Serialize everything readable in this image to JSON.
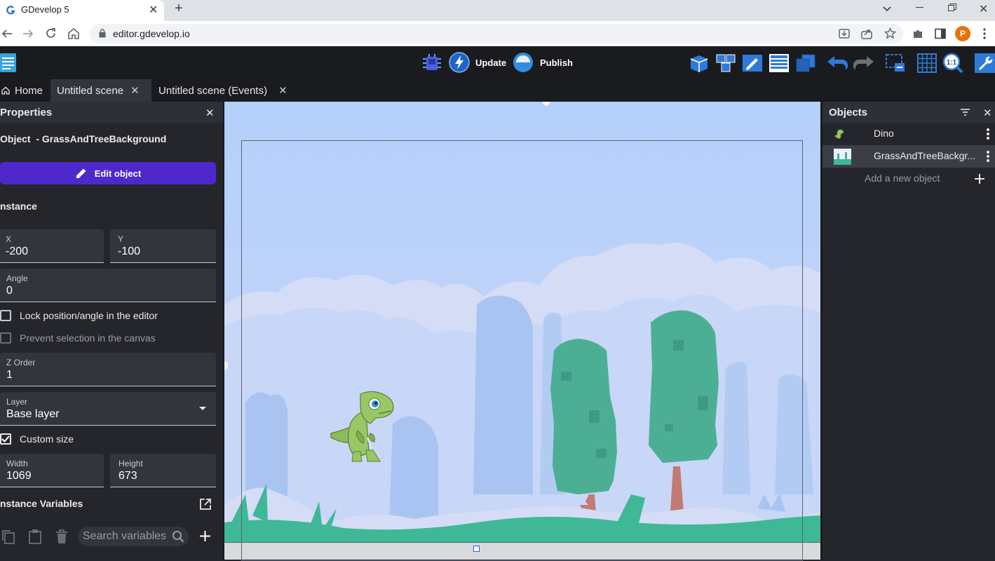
{
  "browser": {
    "tab_title": "GDevelop 5",
    "url": "editor.gdevelop.io",
    "profile_initial": "P"
  },
  "app_toolbar": {
    "update_label": "Update",
    "publish_label": "Publish",
    "zoom_reset_label": "1:1"
  },
  "editor_tabs": [
    {
      "label": "Home"
    },
    {
      "label": "Untitled scene"
    },
    {
      "label": "Untitled scene (Events)"
    }
  ],
  "properties": {
    "title": "Properties",
    "object_line": "Object  - GrassAndTreeBackground",
    "edit_button": "Edit object",
    "instance_heading": "nstance",
    "x": {
      "label": "X",
      "value": "-200"
    },
    "y": {
      "label": "Y",
      "value": "-100"
    },
    "angle": {
      "label": "Angle",
      "value": "0"
    },
    "lock_label": "Lock position/angle in the editor",
    "lock_checked": false,
    "prevent_label": "Prevent selection in the canvas",
    "prevent_checked": false,
    "z_order": {
      "label": "Z Order",
      "value": "1"
    },
    "layer": {
      "label": "Layer",
      "value": "Base layer"
    },
    "custom_size_label": "Custom size",
    "custom_size_checked": true,
    "width": {
      "label": "Width",
      "value": "1069"
    },
    "height": {
      "label": "Height",
      "value": "673"
    },
    "instance_variables_heading": "nstance Variables",
    "variable_search_placeholder": "Search variables"
  },
  "objects_panel": {
    "title": "Objects",
    "items": [
      {
        "name": "Dino",
        "icon": "dino-thumbnail"
      },
      {
        "name": "GrassAndTreeBackgr...",
        "icon": "background-thumbnail",
        "selected": true
      }
    ],
    "add_label": "Add a new object"
  },
  "colors": {
    "accent": "#4f28cd",
    "panel_bg": "#25262c",
    "toolbar_bg": "#1a1b1f",
    "sky": "#b7d2fa",
    "tree": "#4caf94",
    "grass": "#3fb896"
  }
}
